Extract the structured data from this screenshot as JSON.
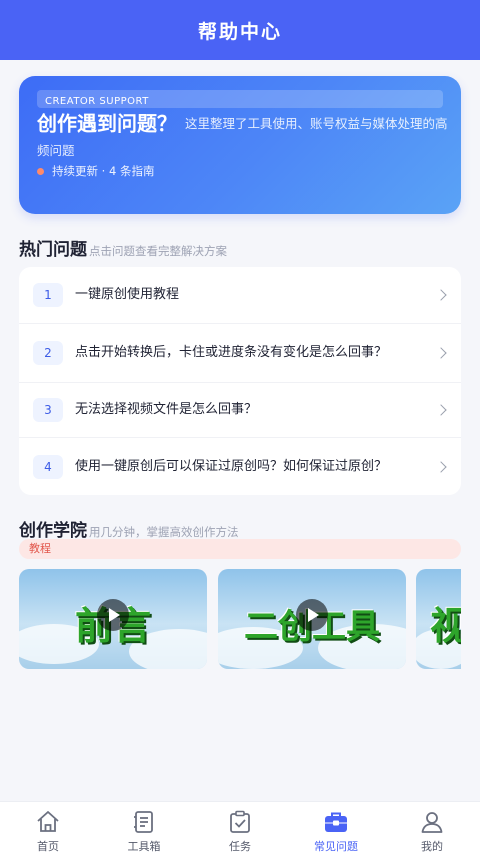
{
  "header": {
    "title": "帮助中心"
  },
  "hero": {
    "badge": "CREATOR SUPPORT",
    "title": "创作遇到问题？",
    "description": "这里整理了工具使用、账号权益与媒体处理的高频问题",
    "meta": "持续更新 · 4 条指南"
  },
  "faq_section": {
    "title": "热门问题",
    "subtitle": "点击问题查看完整解决方案",
    "items": [
      {
        "number": "1",
        "text": "一键原创使用教程"
      },
      {
        "number": "2",
        "text": "点击开始转换后，卡住或进度条没有变化是怎么回事？"
      },
      {
        "number": "3",
        "text": "无法选择视频文件是怎么回事？"
      },
      {
        "number": "4",
        "text": "使用一键原创后可以保证过原创吗？如何保证过原创？"
      }
    ]
  },
  "academy": {
    "title": "创作学院",
    "subtitle": "用几分钟，掌握高效创作方法",
    "tag": "教程",
    "videos": [
      {
        "title": "前言"
      },
      {
        "title": "二创工具"
      },
      {
        "title": "视"
      }
    ]
  },
  "tabbar": {
    "items": [
      {
        "label": "首页",
        "icon": "home-icon"
      },
      {
        "label": "工具箱",
        "icon": "toolbox-icon"
      },
      {
        "label": "任务",
        "icon": "task-icon"
      },
      {
        "label": "常见问题",
        "icon": "faq-icon",
        "active": true
      },
      {
        "label": "我的",
        "icon": "user-icon"
      }
    ]
  },
  "colors": {
    "primary": "#4a63f5",
    "accent": "#e2574c",
    "video_title": "#2ea52b"
  }
}
